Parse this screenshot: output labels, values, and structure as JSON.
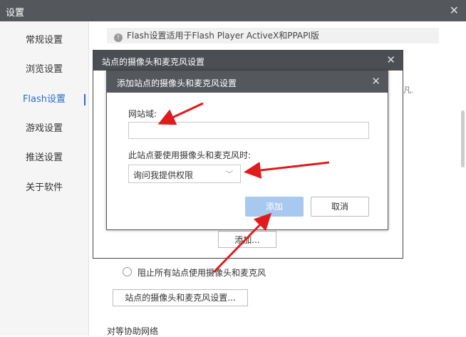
{
  "window": {
    "title": "设置",
    "close": "✕"
  },
  "sidebar": {
    "items": [
      {
        "label": "常规设置"
      },
      {
        "label": "浏览设置"
      },
      {
        "label": "Flash设置"
      },
      {
        "label": "游戏设置"
      },
      {
        "label": "推送设置"
      },
      {
        "label": "关于软件"
      }
    ]
  },
  "main": {
    "info_icon": "!",
    "info": "Flash设置适用于Flash Player ActiveX和PPAPI版",
    "partial_text": "凡.",
    "bg_add_button": "添加...",
    "block_all_label": "阻止所有站点使用摄像头和麦克风",
    "site_settings_button": "站点的摄像头和麦克风设置...",
    "bottom_label": "对等协助网络"
  },
  "outer_dialog": {
    "title": "站点的摄像头和麦克风设置",
    "close": "✕"
  },
  "inner_dialog": {
    "title": "添加站点的摄像头和麦克风设置",
    "close": "✕",
    "domain_label": "网站域:",
    "domain_value": "",
    "permission_label": "此站点要使用摄像头和麦克风时:",
    "permission_selected": "询问我提供权限",
    "add_button": "添加",
    "cancel_button": "取消"
  },
  "colors": {
    "accent": "#2a6fc9",
    "arrow": "#e01b1b",
    "titlebar": "#54585d"
  }
}
